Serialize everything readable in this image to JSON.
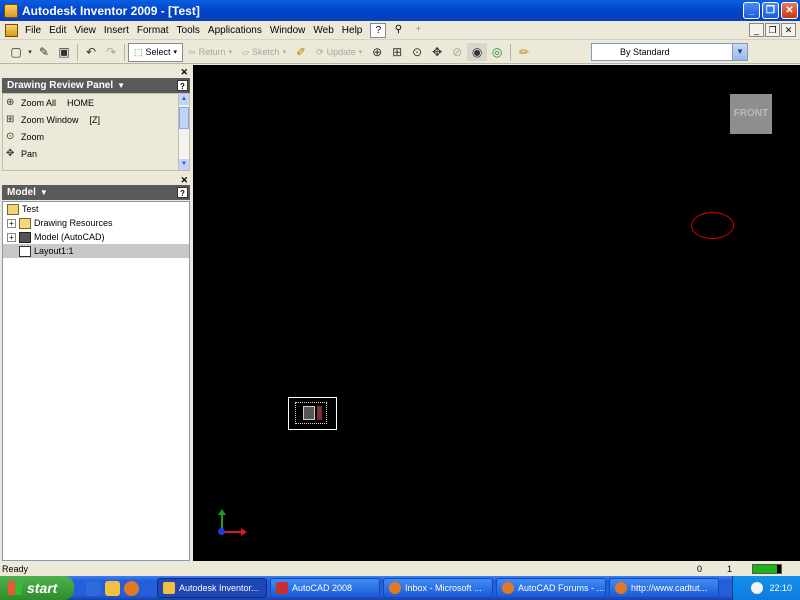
{
  "window": {
    "title": "Autodesk Inventor 2009 - [Test]",
    "buttons": [
      "_",
      "❐",
      "✕"
    ]
  },
  "menubar": {
    "items": [
      "File",
      "Edit",
      "View",
      "Insert",
      "Format",
      "Tools",
      "Applications",
      "Window",
      "Web",
      "Help"
    ],
    "mdi_buttons": [
      "_",
      "❐",
      "✕"
    ]
  },
  "toolbar": {
    "select_label": "Select",
    "return_label": "Return",
    "sketch_label": "Sketch",
    "update_label": "Update",
    "style_value": "By Standard"
  },
  "review_panel": {
    "title": "Drawing Review Panel",
    "items": [
      {
        "label": "Zoom All",
        "extra": "HOME",
        "icon": "zoom-all-icon"
      },
      {
        "label": "Zoom Window",
        "extra": "[Z]",
        "icon": "zoom-window-icon"
      },
      {
        "label": "Zoom",
        "extra": "",
        "icon": "zoom-icon"
      },
      {
        "label": "Pan",
        "extra": "",
        "icon": "pan-icon"
      }
    ]
  },
  "model_panel": {
    "title": "Model",
    "tree": [
      {
        "label": "Test",
        "icon": "drawing-icon"
      },
      {
        "label": "Drawing Resources",
        "icon": "folder-icon"
      },
      {
        "label": "Model (AutoCAD)",
        "icon": "model-icon"
      },
      {
        "label": "Layout1:1",
        "icon": "layout-icon"
      }
    ]
  },
  "canvas": {
    "viewcube_label": "FRONT"
  },
  "statusbar": {
    "text": "Ready",
    "count_a": "0",
    "count_b": "1",
    "gauge_fill": 0.85
  },
  "taskbar": {
    "start_label": "start",
    "tasks": [
      {
        "label": "Autodesk Inventor..."
      },
      {
        "label": "AutoCAD 2008"
      },
      {
        "label": "Inbox - Microsoft ..."
      },
      {
        "label": "AutoCAD Forums - ..."
      },
      {
        "label": "http://www.cadtut..."
      }
    ],
    "clock": "22:10"
  },
  "colors": {
    "titlebar": "#0a5fe0",
    "canvas_bg": "#000000",
    "ellipse": "#dd0000",
    "axis_x": "#d81c1c",
    "axis_y": "#1c9e1c",
    "axis_z": "#1f3ad9"
  }
}
